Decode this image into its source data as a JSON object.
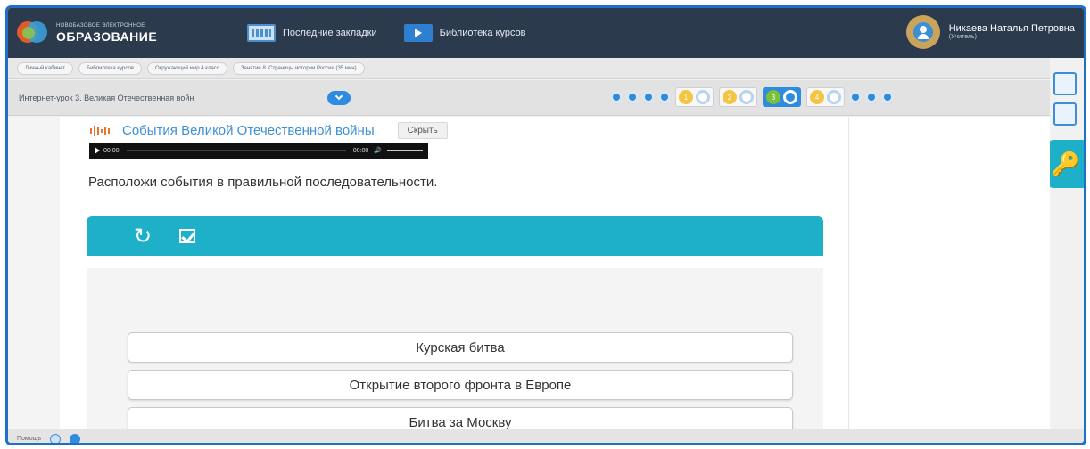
{
  "header": {
    "logo_small": "НОВОБАЗОВОЕ ЭЛЕКТРОННОЕ",
    "logo_big": "ОБРАЗОВАНИЕ",
    "nav": [
      {
        "label": "Последние закладки",
        "icon": "bookmarks-icon"
      },
      {
        "label": "Библиотека курсов",
        "icon": "library-icon"
      }
    ],
    "user": {
      "name": "Никаева Наталья Петровна",
      "role": "(Учитель)"
    }
  },
  "breadcrumbs": [
    "Личный кабинет",
    "Библиотека курсов",
    "Окружающий мир 4 класс",
    "Занятие 8. Страницы истории России (35 мин)"
  ],
  "lesson": {
    "title": "Интернет-урок 3. Великая Отечественная войн",
    "steps": [
      "1",
      "2",
      "3",
      "4"
    ],
    "active_step": 3
  },
  "section": {
    "title": "События Великой Отечественной войны",
    "hide_label": "Скрыть",
    "player": {
      "time_start": "00:00",
      "time_end": "00:00"
    }
  },
  "instruction": "Расположи события в правильной последовательности.",
  "items": [
    "Курская битва",
    "Открытие второго фронта в Европе",
    "Битва за Москву"
  ],
  "status": {
    "label": "Помощь"
  },
  "colors": {
    "topbar": "#2b3a4d",
    "accent": "#1fb0c9",
    "link": "#3d8fd4",
    "primary": "#2f8be0"
  }
}
